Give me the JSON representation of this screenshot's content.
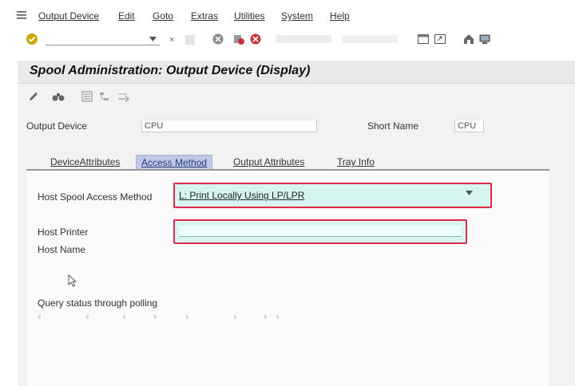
{
  "menubar": {
    "items": [
      "Output Device",
      "Edit",
      "Goto",
      "Extras",
      "Utilities",
      "System",
      "Help"
    ]
  },
  "icons": {
    "menu": "menu-icon",
    "enter": "enter-check-icon",
    "save": "save-icon",
    "back": "back-icon",
    "exit": "exit-icon",
    "cancel": "cancel-icon",
    "layout": "window-layout-icon",
    "help": "help-icon",
    "monitor": "monitor-icon"
  },
  "page": {
    "title": "Spool Administration: Output Device (Display)"
  },
  "header_fields": {
    "output_device_label": "Output Device",
    "output_device_value": "CPU",
    "short_name_label": "Short Name",
    "short_name_value": "CPU"
  },
  "tabs": [
    "DeviceAttributes",
    "Access Method",
    "Output Attributes",
    "Tray Info"
  ],
  "access_method": {
    "method_label": "Host Spool Access Method",
    "method_value": "L: Print Locally Using LP/LPR",
    "printer_label": "Host Printer",
    "hostname_label": "Host Name",
    "query_label": "Query status through polling"
  },
  "colors": {
    "highlight_border": "#e0294a",
    "input_fill": "#d6f5f0",
    "active_tab": "#bfc8e6"
  }
}
